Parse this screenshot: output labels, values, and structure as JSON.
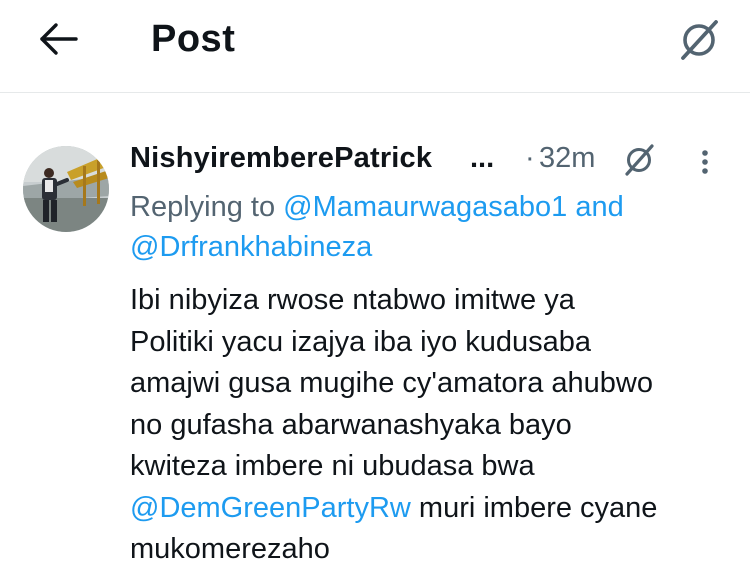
{
  "header": {
    "title": "Post"
  },
  "post": {
    "author_name": "NishyiremberePatrick",
    "author_truncation": "...",
    "separator": "·",
    "time": "32m",
    "replying": {
      "prefix": "Replying to",
      "mention1": "@Mamaurwagasabo1",
      "conjunction": "and",
      "mention2": "@Drfrankhabineza"
    },
    "text": {
      "line1": "Ibi nibyiza rwose ntabwo imitwe ya",
      "line2": "Politiki yacu izajya iba iyo kudusaba",
      "line3": "amajwi gusa mugihe cy'amatora ahubwo",
      "line4": "no gufasha abarwanashyaka bayo",
      "line5": "kwiteza imbere ni ubudasa bwa",
      "line6_mention": "@DemGreenPartyRw",
      "line6_rest": "muri imbere cyane",
      "line7": "mukomerezaho"
    }
  },
  "colors": {
    "text": "#0f1419",
    "secondary": "#536471",
    "link": "#1d9bf0",
    "divider": "#e6e9ea"
  },
  "icons": {
    "back": "arrow-left-icon",
    "grok": "grok-icon",
    "more": "more-vertical-icon"
  }
}
